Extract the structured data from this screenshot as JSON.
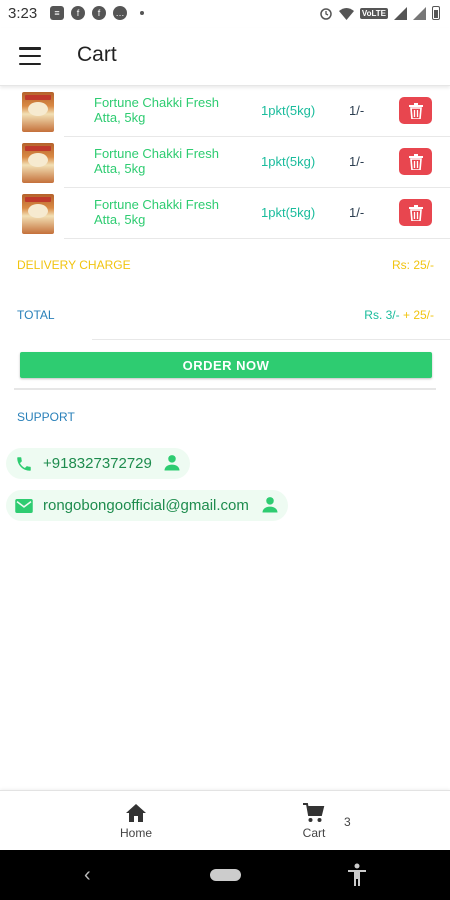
{
  "status_bar": {
    "time": "3:23",
    "network_label": "VoLTE",
    "left_icons": [
      "document-icon",
      "facebook-icon",
      "facebook-icon",
      "messenger-icon",
      "dot-icon"
    ],
    "right_icons": [
      "alarm-icon",
      "wifi-icon",
      "volte-badge",
      "signal-icon",
      "signal-icon",
      "battery-icon"
    ]
  },
  "app_bar": {
    "title": "Cart",
    "menu_icon": "menu-icon"
  },
  "cart_items": [
    {
      "name": "Fortune Chakki Fresh Atta, 5kg",
      "quantity": "1pkt(5kg)",
      "price": "1/-"
    },
    {
      "name": "Fortune Chakki Fresh Atta, 5kg",
      "quantity": "1pkt(5kg)",
      "price": "1/-"
    },
    {
      "name": "Fortune Chakki Fresh Atta, 5kg",
      "quantity": "1pkt(5kg)",
      "price": "1/-"
    }
  ],
  "summary": {
    "delivery_label": "DELIVERY CHARGE",
    "delivery_value": "Rs: 25/-",
    "total_label": "TOTAL",
    "total_value_main": "Rs. 3/-",
    "total_value_extra": " + 25/-"
  },
  "order_button": {
    "label": "ORDER NOW"
  },
  "support": {
    "label": "SUPPORT",
    "phone": "+918327372729",
    "email": "rongobongoofficial@gmail.com"
  },
  "bottom_nav": {
    "home_label": "Home",
    "cart_label": "Cart",
    "cart_count": "3"
  },
  "colors": {
    "accent_green": "#2ecc71",
    "delete_red": "#e8464f",
    "delivery_yellow": "#f1c40f",
    "total_blue": "#2980b9"
  }
}
